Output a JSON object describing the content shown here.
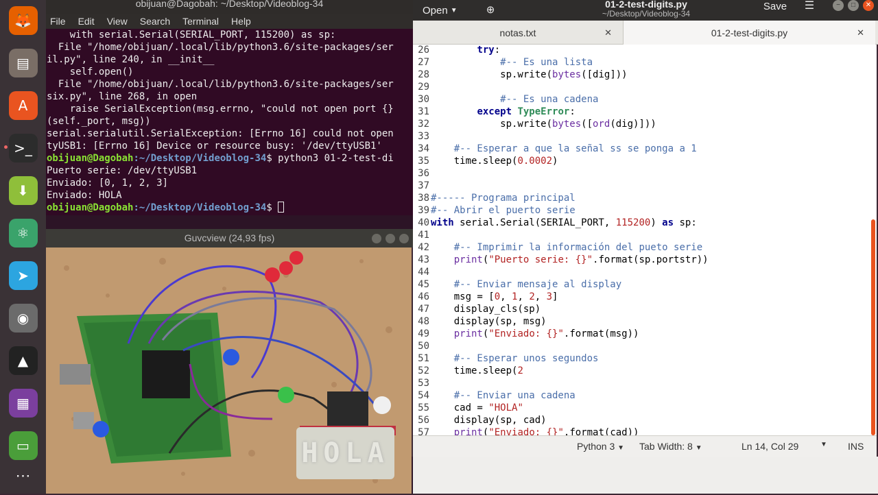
{
  "dock": {
    "items": [
      {
        "name": "firefox-icon",
        "glyph": "🦊",
        "color": "#e66000"
      },
      {
        "name": "files-icon",
        "glyph": "▤",
        "color": "#7a6e66"
      },
      {
        "name": "software-center-icon",
        "glyph": "A",
        "color": "#e95420"
      },
      {
        "name": "terminal-icon",
        "glyph": ">_",
        "color": "#2c2c2c"
      },
      {
        "name": "download-icon",
        "glyph": "⬇",
        "color": "#8fbf3a"
      },
      {
        "name": "atom-icon",
        "glyph": "⚛",
        "color": "#3aa36b"
      },
      {
        "name": "telegram-icon",
        "glyph": "➤",
        "color": "#2ca5e0"
      },
      {
        "name": "gimp-icon",
        "glyph": "◉",
        "color": "#6b6b6b"
      },
      {
        "name": "inkscape-icon",
        "glyph": "▲",
        "color": "#222222"
      },
      {
        "name": "video-editor-icon",
        "glyph": "▦",
        "color": "#7b3f9e"
      },
      {
        "name": "serial-monitor-icon",
        "glyph": "▭",
        "color": "#4a9e3a"
      }
    ],
    "apps_glyph": "⋯"
  },
  "terminal": {
    "title": "obijuan@Dagobah: ~/Desktop/Videoblog-34",
    "menu": [
      "File",
      "Edit",
      "View",
      "Search",
      "Terminal",
      "Help"
    ],
    "lines": [
      "    with serial.Serial(SERIAL_PORT, 115200) as sp:",
      "  File \"/home/obijuan/.local/lib/python3.6/site-packages/ser",
      "il.py\", line 240, in __init__",
      "    self.open()",
      "  File \"/home/obijuan/.local/lib/python3.6/site-packages/ser",
      "six.py\", line 268, in open",
      "    raise SerialException(msg.errno, \"could not open port {}",
      "(self._port, msg))",
      "serial.serialutil.SerialException: [Errno 16] could not open",
      "tyUSB1: [Errno 16] Device or resource busy: '/dev/ttyUSB1'"
    ],
    "prompt_user": "obijuan@Dagobah",
    "prompt_path": ":~/Desktop/Videoblog-34",
    "prompt_sign": "$ ",
    "command": "python3 01-2-test-di",
    "out1": "Puerto serie: /dev/ttyUSB1",
    "out2": "Enviado: [0, 1, 2, 3]",
    "out3": "Enviado: HOLA"
  },
  "guvcview": {
    "title": "Guvcview  (24,93 fps)",
    "display_text": "HOLA"
  },
  "editor": {
    "open_label": "Open",
    "title": "01-2-test-digits.py",
    "subtitle": "~/Desktop/Videoblog-34",
    "save_label": "Save",
    "tabs": [
      {
        "label": "notas.txt"
      },
      {
        "label": "01-2-test-digits.py"
      }
    ],
    "lines": [
      {
        "n": "26",
        "t": "        try:"
      },
      {
        "n": "27",
        "t": "            #-- Es una lista"
      },
      {
        "n": "28",
        "t": "            sp.write(bytes([dig]))"
      },
      {
        "n": "29",
        "t": ""
      },
      {
        "n": "30",
        "t": "            #-- Es una cadena"
      },
      {
        "n": "31",
        "t": "        except TypeError:"
      },
      {
        "n": "32",
        "t": "            sp.write(bytes([ord(dig)]))"
      },
      {
        "n": "33",
        "t": ""
      },
      {
        "n": "34",
        "t": "    #-- Esperar a que la señal ss se ponga a 1"
      },
      {
        "n": "35",
        "t": "    time.sleep(0.0002)"
      },
      {
        "n": "36",
        "t": ""
      },
      {
        "n": "37",
        "t": ""
      },
      {
        "n": "38",
        "t": "#----- Programa principal"
      },
      {
        "n": "39",
        "t": "#-- Abrir el puerto serie"
      },
      {
        "n": "40",
        "t": "with serial.Serial(SERIAL_PORT, 115200) as sp:"
      },
      {
        "n": "41",
        "t": ""
      },
      {
        "n": "42",
        "t": "    #-- Imprimir la información del pueto serie"
      },
      {
        "n": "43",
        "t": "    print(\"Puerto serie: {}\".format(sp.portstr))"
      },
      {
        "n": "44",
        "t": ""
      },
      {
        "n": "45",
        "t": "    #-- Enviar mensaje al display"
      },
      {
        "n": "46",
        "t": "    msg = [0, 1, 2, 3]"
      },
      {
        "n": "47",
        "t": "    display_cls(sp)"
      },
      {
        "n": "48",
        "t": "    display(sp, msg)"
      },
      {
        "n": "49",
        "t": "    print(\"Enviado: {}\".format(msg))"
      },
      {
        "n": "50",
        "t": ""
      },
      {
        "n": "51",
        "t": "    #-- Esperar unos segundos"
      },
      {
        "n": "52",
        "t": "    time.sleep(2"
      },
      {
        "n": "53",
        "t": ""
      },
      {
        "n": "54",
        "t": "    #-- Enviar una cadena"
      },
      {
        "n": "55",
        "t": "    cad = \"HOLA\""
      },
      {
        "n": "56",
        "t": "    display(sp, cad)"
      },
      {
        "n": "57",
        "t": "    print(\"Enviado: {}\".format(cad))"
      }
    ],
    "status": {
      "language": "Python 3",
      "tab_width": "Tab Width: 8",
      "position": "Ln 14, Col 29",
      "mode": "INS"
    }
  }
}
